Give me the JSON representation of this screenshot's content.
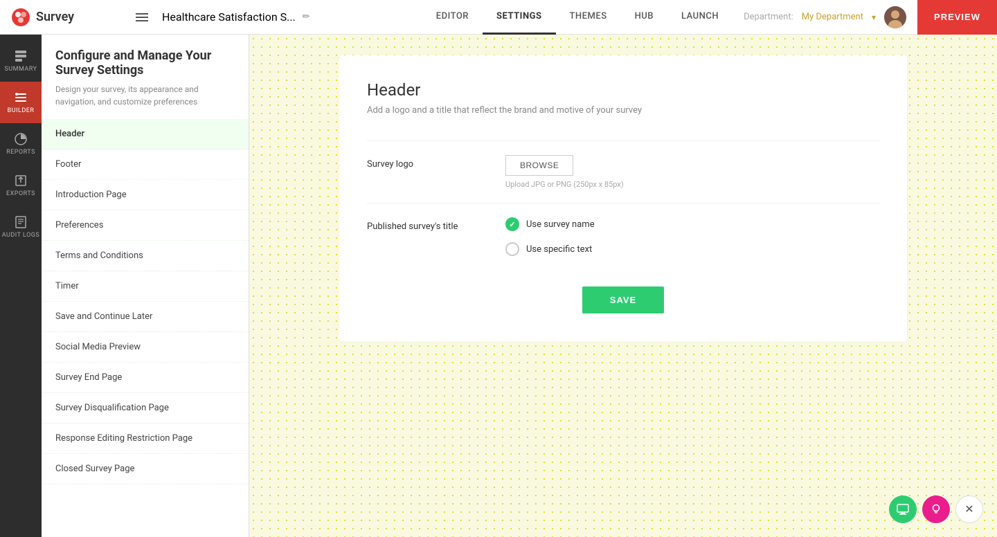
{
  "app": {
    "name": "Survey"
  },
  "topbar": {
    "hamburger_label": "menu",
    "survey_title": "Healthcare Satisfaction S...",
    "edit_icon": "✏",
    "nav_items": [
      {
        "label": "EDITOR",
        "active": false
      },
      {
        "label": "SETTINGS",
        "active": true
      },
      {
        "label": "THEMES",
        "active": false
      },
      {
        "label": "HUB",
        "active": false
      },
      {
        "label": "LAUNCH",
        "active": false
      }
    ],
    "dept_label": "Department:",
    "dept_value": "My Department",
    "preview_label": "PREVIEW"
  },
  "sidebar": {
    "items": [
      {
        "label": "SUMMARY",
        "icon": "summary"
      },
      {
        "label": "BUILDER",
        "icon": "builder",
        "active": true
      },
      {
        "label": "REPORTS",
        "icon": "reports"
      },
      {
        "label": "EXPORTS",
        "icon": "exports"
      },
      {
        "label": "AUDIT LOGS",
        "icon": "audit"
      }
    ]
  },
  "settings_menu": {
    "title": "Configure and Manage Your Survey Settings",
    "desc": "Design your survey, its appearance and navigation, and customize preferences",
    "items": [
      {
        "label": "Header",
        "active": true
      },
      {
        "label": "Footer"
      },
      {
        "label": "Introduction Page"
      },
      {
        "label": "Preferences"
      },
      {
        "label": "Terms and Conditions"
      },
      {
        "label": "Timer"
      },
      {
        "label": "Save and Continue Later"
      },
      {
        "label": "Social Media Preview"
      },
      {
        "label": "Survey End Page"
      },
      {
        "label": "Survey Disqualification Page"
      },
      {
        "label": "Response Editing Restriction Page"
      },
      {
        "label": "Closed Survey Page"
      }
    ]
  },
  "content": {
    "card_title": "Header",
    "card_subtitle": "Add a logo and a title that reflect the brand and motive of your survey",
    "survey_logo_label": "Survey logo",
    "browse_label": "BROWSE",
    "upload_hint": "Upload JPG or PNG (250px x 85px)",
    "published_title_label": "Published survey's title",
    "radio_options": [
      {
        "label": "Use survey name",
        "checked": true
      },
      {
        "label": "Use specific text",
        "checked": false
      }
    ],
    "save_label": "SAVE"
  }
}
